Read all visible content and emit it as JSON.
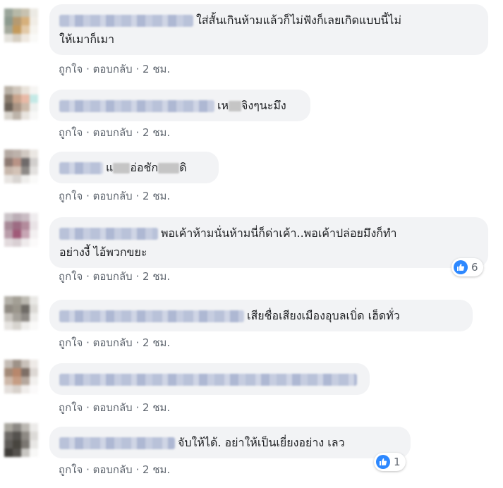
{
  "actions": {
    "like": "ถูกใจ",
    "reply": "ตอบกลับ",
    "sep": "·",
    "time": "2 ชม."
  },
  "comments": [
    {
      "text_line1": "ใส่สั้นเกินห้ามแล้วก็ไม่ฟังก็เลยเกิดแบบนี้ไม่",
      "text_line2": "ให้เมาก็เมา"
    },
    {
      "text_prefix": "เห",
      "text": "จิงๆนะมึง"
    },
    {
      "text_prefix": "แ",
      "text_mid": "อ่อชัก",
      "text": "ดิ"
    },
    {
      "text_line1": "พอเค้าห้ามนั่นห้ามนี่ก็ด่าเค้า..พอเค้าปล่อยมึงก็ทำ",
      "text_line2": "อย่างงี้ ไอ้พวกขยะ",
      "reactions": "6"
    },
    {
      "text": "เสียชื่อเสียงเมืองอุบลเบิ่ด เฮ็ดทั่ว"
    },
    {
      "text": ""
    },
    {
      "text": "จับให้ได้. อย่าให้เป็นเยี่ยงอย่าง เลว",
      "reactions": "1"
    }
  ],
  "colors": {
    "like_blue": "#2d88ff",
    "bubble_bg": "#f2f3f5",
    "meta_gray": "#606770"
  }
}
